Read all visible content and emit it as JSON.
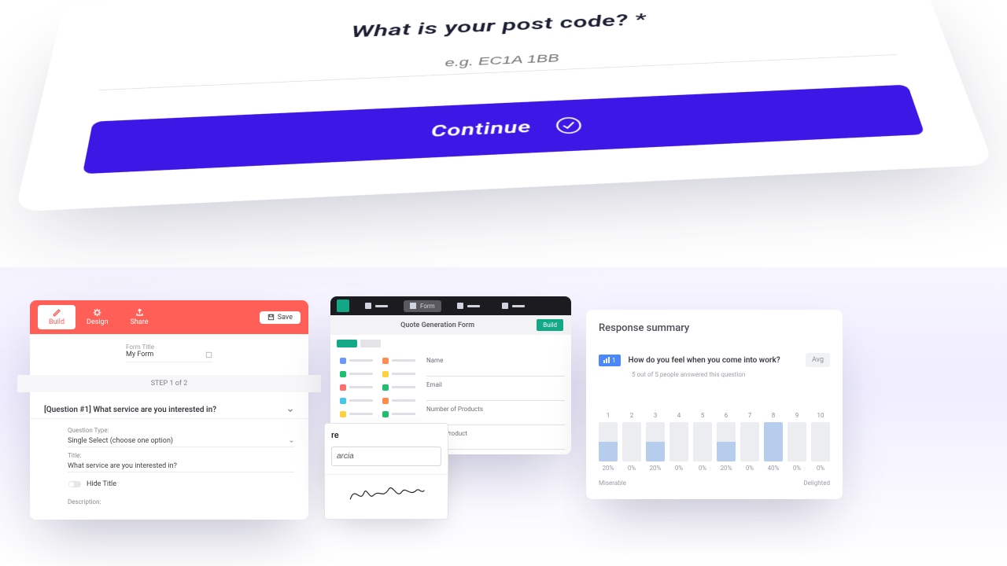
{
  "hero": {
    "question": "What is your post code? *",
    "placeholder": "e.g. EC1A 1BB",
    "button_label": "Continue"
  },
  "card1": {
    "tabs": [
      "Build",
      "Design",
      "Share"
    ],
    "save_label": "Save",
    "form_title_label": "Form Title",
    "form_title_value": "My Form",
    "step_text": "STEP 1 of 2",
    "question_header": "[Question #1] What service are you interested in?",
    "type_label": "Question Type:",
    "type_value": "Single Select (choose one option)",
    "title_label": "Title:",
    "title_value": "What service are you interested in?",
    "hide_title_label": "Hide Title",
    "description_label": "Description:"
  },
  "card2": {
    "nav_active": "Form",
    "form_title": "Quote Generation Form",
    "build_tag": "Build",
    "fields": [
      "Name",
      "Email",
      "Number of Products",
      "Select Product"
    ],
    "chip_colors": [
      "#6b99ff",
      "#ff8b4d",
      "#1ec06f",
      "#ffd23d",
      "#ff6d6d",
      "#1ec06f",
      "#48c6e6",
      "#ff8b4d",
      "#ffd23d",
      "#1ec06f",
      "#48c6e6",
      "#ff6d6d"
    ]
  },
  "signature": {
    "label": "re",
    "input_value": "arcia"
  },
  "card3": {
    "title": "Response summary",
    "badge_num": "1",
    "question": "How do you feel when you come into work?",
    "answered_text": "5 out of 5 people answered this question",
    "avg_label": "Avg",
    "left_label": "Miserable",
    "right_label": "Delighted"
  },
  "chart_data": {
    "type": "bar",
    "categories": [
      "1",
      "2",
      "3",
      "4",
      "5",
      "6",
      "7",
      "8",
      "9",
      "10"
    ],
    "values": [
      20,
      0,
      20,
      0,
      0,
      20,
      0,
      40,
      0,
      0
    ],
    "xlabel": "",
    "ylabel": "%",
    "ylim": [
      0,
      100
    ],
    "title": "How do you feel when you come into work?"
  }
}
